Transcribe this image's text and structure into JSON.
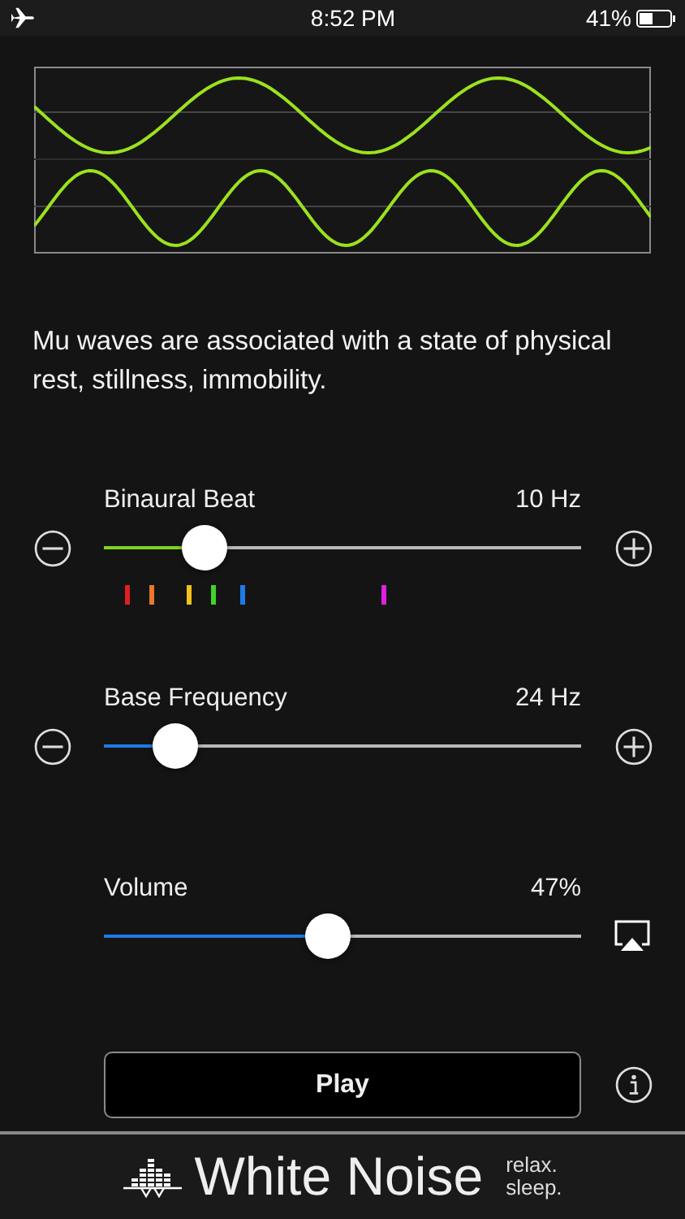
{
  "status_bar": {
    "time": "8:52 PM",
    "battery": "41%"
  },
  "description": "Mu waves are associated with a state of physical rest, stillness, immobility.",
  "sliders": [
    {
      "kind": "stepper",
      "label": "Binaural Beat",
      "reading": "10 Hz",
      "level": 0.21,
      "color": "#7ed321",
      "markers": [
        {
          "color": "#e0201e"
        },
        {
          "color": "#e8782a"
        },
        {
          "color": "#f2c21c"
        },
        {
          "color": "#3fd42a"
        },
        {
          "color": "#1e7be6"
        },
        {
          "color": "#e020e0"
        }
      ]
    },
    {
      "kind": "stepper",
      "label": "Base Frequency",
      "reading": "24 Hz",
      "level": 0.15,
      "color": "#1e7be6"
    },
    {
      "kind": "airplay",
      "label": "Volume",
      "reading": "47%",
      "level": 0.47,
      "color": "#1e7be6"
    }
  ],
  "play_button": "Play",
  "footer": {
    "brand": "White Noise",
    "tagline_1": "relax.",
    "tagline_2": "sleep."
  }
}
